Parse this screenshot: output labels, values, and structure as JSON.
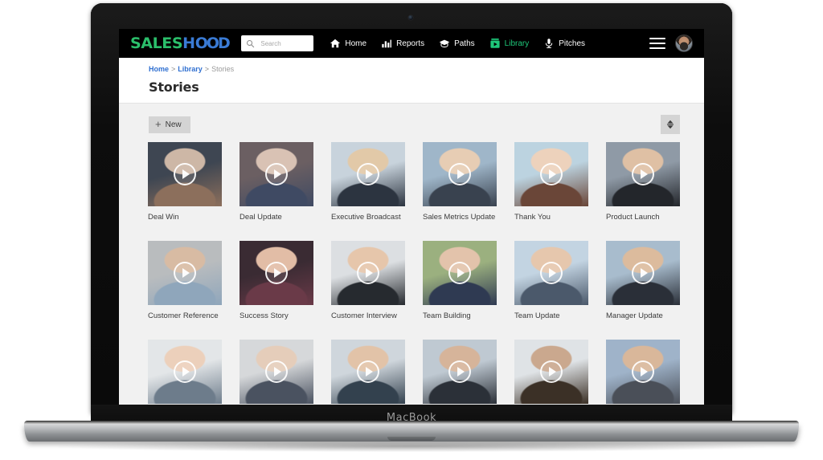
{
  "device": {
    "brand_label": "MacBook"
  },
  "navbar": {
    "logo_part1": "SALES",
    "logo_part2": "H",
    "logo_oo": "OO",
    "logo_part3": "D",
    "search": {
      "placeholder": "Search",
      "value": ""
    },
    "items": [
      {
        "label": "Home",
        "icon": "home-icon",
        "active": false
      },
      {
        "label": "Reports",
        "icon": "bar-chart-icon",
        "active": false
      },
      {
        "label": "Paths",
        "icon": "graduation-cap-icon",
        "active": false
      },
      {
        "label": "Library",
        "icon": "library-video-icon",
        "active": true
      },
      {
        "label": "Pitches",
        "icon": "microphone-icon",
        "active": false
      }
    ],
    "menu_icon": "hamburger-menu-icon",
    "avatar_icon": "user-avatar",
    "accent_green": "#1ec87a",
    "accent_blue": "#3a7bd5"
  },
  "header": {
    "breadcrumb": {
      "home": "Home",
      "library": "Library",
      "current": "Stories",
      "separator": ">"
    },
    "title": "Stories"
  },
  "toolbar": {
    "new_label": "New",
    "new_icon": "plus-icon",
    "sort_icon": "sort-updown-icon"
  },
  "grid": {
    "rows": [
      {
        "cards": [
          {
            "label": "Deal Win",
            "play_icon": "play-icon"
          },
          {
            "label": "Deal Update",
            "play_icon": "play-icon"
          },
          {
            "label": "Executive Broadcast",
            "play_icon": "play-icon"
          },
          {
            "label": "Sales Metrics Update",
            "play_icon": "play-icon"
          },
          {
            "label": "Thank You",
            "play_icon": "play-icon"
          },
          {
            "label": "Product Launch",
            "play_icon": "play-icon"
          }
        ]
      },
      {
        "cards": [
          {
            "label": "Customer Reference",
            "play_icon": "play-icon"
          },
          {
            "label": "Success Story",
            "play_icon": "play-icon"
          },
          {
            "label": "Customer Interview",
            "play_icon": "play-icon"
          },
          {
            "label": "Team Building",
            "play_icon": "play-icon"
          },
          {
            "label": "Team Update",
            "play_icon": "play-icon"
          },
          {
            "label": "Manager Update",
            "play_icon": "play-icon"
          }
        ]
      },
      {
        "cards": [
          {
            "label": "",
            "play_icon": "play-icon"
          },
          {
            "label": "",
            "play_icon": "play-icon"
          },
          {
            "label": "",
            "play_icon": "play-icon"
          },
          {
            "label": "",
            "play_icon": "play-icon"
          },
          {
            "label": "",
            "play_icon": "play-icon"
          },
          {
            "label": "",
            "play_icon": "play-icon"
          }
        ]
      }
    ]
  }
}
